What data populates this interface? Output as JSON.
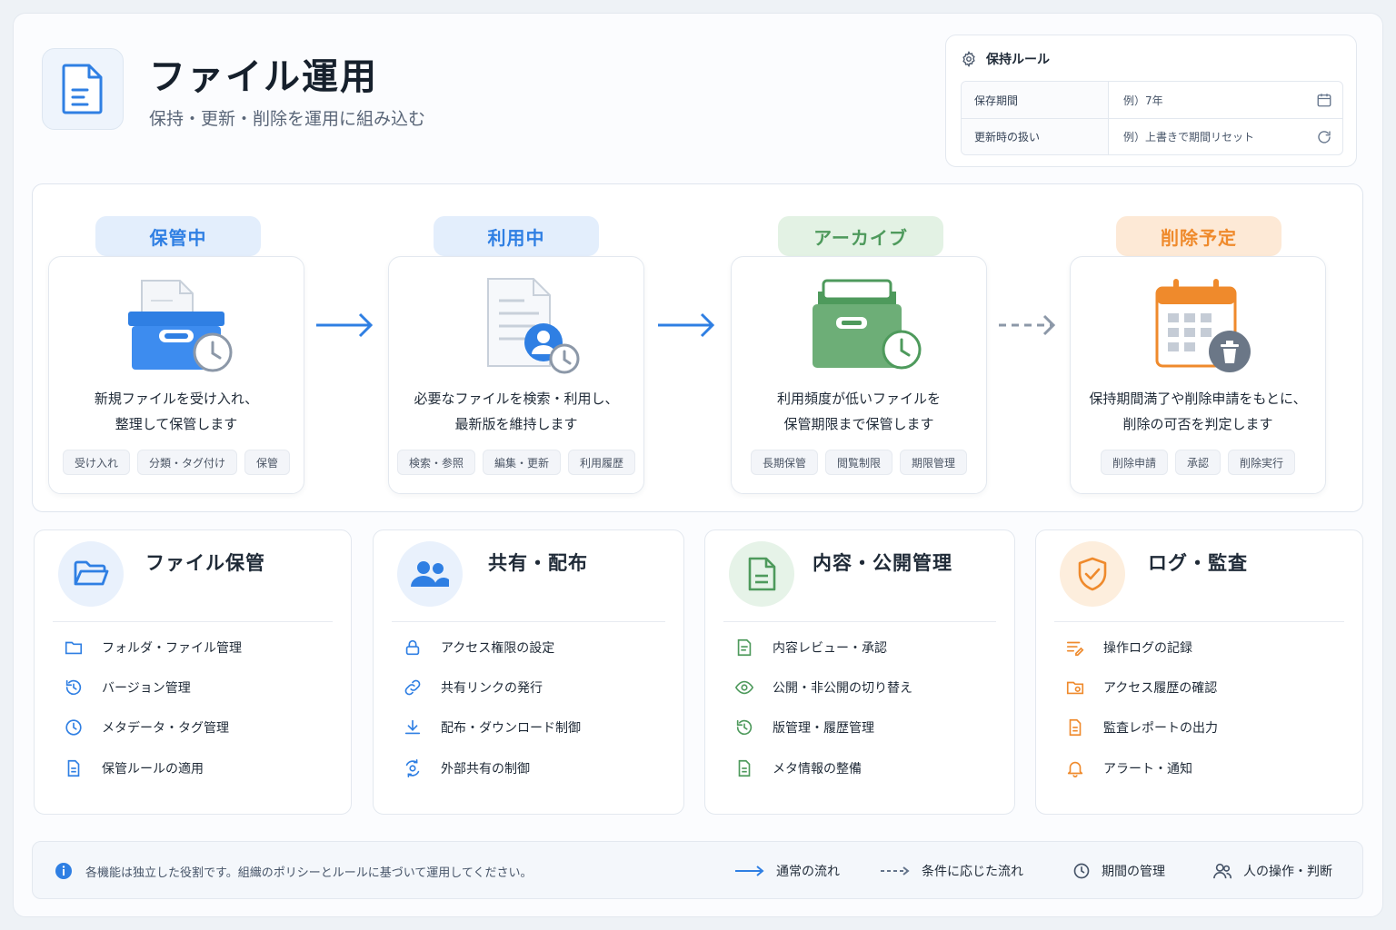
{
  "header": {
    "title": "ファイル運用",
    "subtitle": "保持・更新・削除を運用に組み込む",
    "icon": "document-icon"
  },
  "rules": {
    "title": "保持ルール",
    "rows": [
      {
        "label": "保存期間",
        "value": "例）7年",
        "icon": "calendar-icon"
      },
      {
        "label": "更新時の扱い",
        "value": "例）上書きで期間リセット",
        "icon": "refresh-icon"
      }
    ]
  },
  "stages": [
    {
      "label": "保管中",
      "color": "#2f7fe3",
      "bg": "#e3eefc",
      "desc1": "新規ファイルを受け入れ、",
      "desc2": "整理して保管します",
      "tags": [
        "受け入れ",
        "分類・タグ付け",
        "保管"
      ]
    },
    {
      "label": "利用中",
      "color": "#2f7fe3",
      "bg": "#e3eefc",
      "desc1": "必要なファイルを検索・利用し、",
      "desc2": "最新版を維持します",
      "tags": [
        "検索・参照",
        "編集・更新",
        "利用履歴"
      ]
    },
    {
      "label": "アーカイブ",
      "color": "#4e9a5c",
      "bg": "#e3f2e4",
      "desc1": "利用頻度が低いファイルを",
      "desc2": "保管期限まで保管します",
      "tags": [
        "長期保管",
        "閲覧制限",
        "期限管理"
      ]
    },
    {
      "label": "削除予定",
      "color": "#ef8a2c",
      "bg": "#fde9d6",
      "desc1": "保持期間満了や削除申請をもとに、",
      "desc2": "削除の可否を判定します",
      "tags": [
        "削除申請",
        "承認",
        "削除実行"
      ]
    }
  ],
  "features": [
    {
      "title": "ファイル保管",
      "color": "#2f7fe3",
      "bg": "#e9f1fc",
      "items": [
        "フォルダ・ファイル管理",
        "バージョン管理",
        "メタデータ・タグ管理",
        "保管ルールの適用"
      ]
    },
    {
      "title": "共有・配布",
      "color": "#2f7fe3",
      "bg": "#e9f1fc",
      "items": [
        "アクセス権限の設定",
        "共有リンクの発行",
        "配布・ダウンロード制御",
        "外部共有の制御"
      ]
    },
    {
      "title": "内容・公開管理",
      "color": "#4e9a5c",
      "bg": "#e6f3e8",
      "items": [
        "内容レビュー・承認",
        "公開・非公開の切り替え",
        "版管理・履歴管理",
        "メタ情報の整備"
      ]
    },
    {
      "title": "ログ・監査",
      "color": "#ef8a2c",
      "bg": "#fdeedd",
      "items": [
        "操作ログの記録",
        "アクセス履歴の確認",
        "監査レポートの出力",
        "アラート・通知"
      ]
    }
  ],
  "legend": {
    "note": "各機能は独立した役割です。組織のポリシーとルールに基づいて運用してください。",
    "normal_flow": "通常の流れ",
    "conditional_flow": "条件に応じた流れ",
    "period": "期間の管理",
    "human": "人の操作・判断"
  }
}
